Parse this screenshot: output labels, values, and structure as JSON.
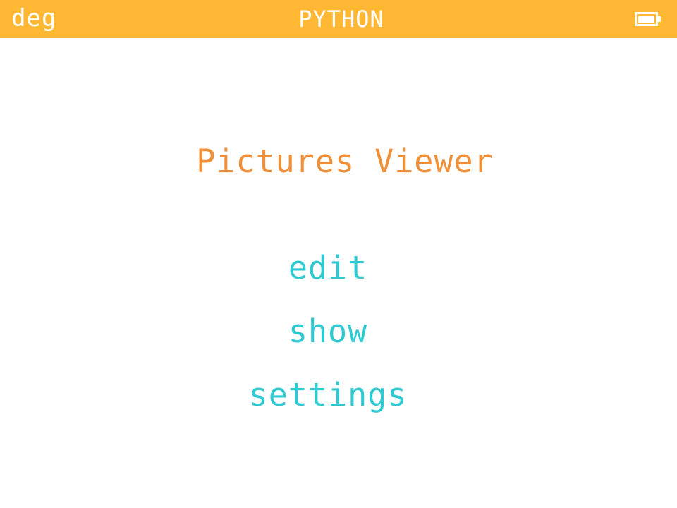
{
  "status_bar": {
    "angle_mode": "deg",
    "app_name": "PYTHON",
    "battery_icon": "battery-full-icon"
  },
  "screen": {
    "title": "Pictures Viewer",
    "menu": [
      {
        "label": "edit"
      },
      {
        "label": "show"
      },
      {
        "label": "settings"
      }
    ]
  },
  "colors": {
    "top_bar": "#ffb734",
    "title": "#ef8f38",
    "menu_text": "#2fc9d2",
    "background": "#ffffff"
  }
}
